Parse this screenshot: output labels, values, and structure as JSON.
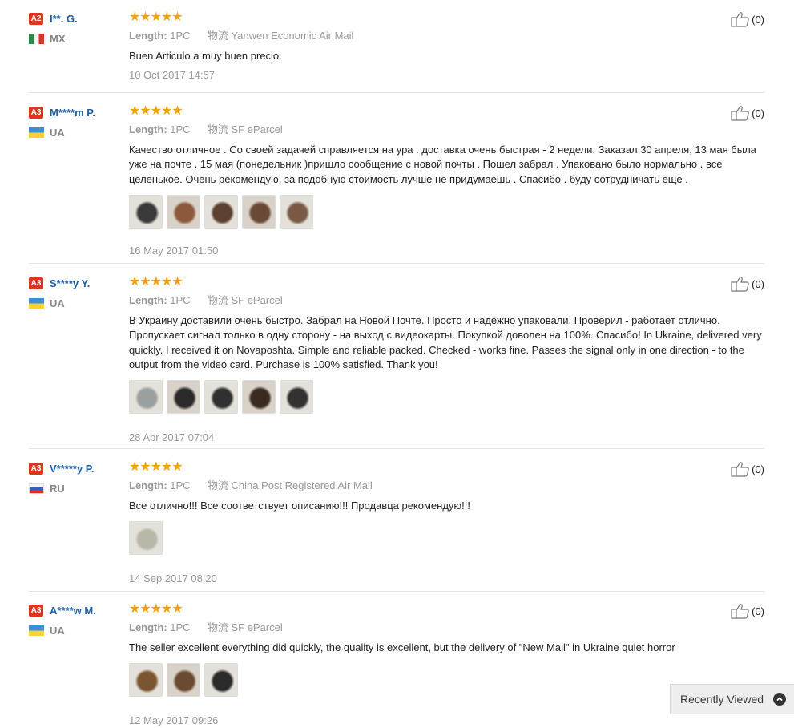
{
  "labels": {
    "length": "Length:",
    "shipping": "物流"
  },
  "reviews": [
    {
      "level": "A2",
      "user": "I**. G.",
      "country": "MX",
      "flag": "mx",
      "stars": "★★★★★",
      "quantity": "1PC",
      "shipping": "Yanwen Economic Air Mail",
      "text": "Buen Articulo a muy buen precio.",
      "photos": [],
      "date": "10 Oct 2017 14:57",
      "likes": "(0)"
    },
    {
      "level": "A3",
      "user": "M****m P.",
      "country": "UA",
      "flag": "ua",
      "stars": "★★★★★",
      "quantity": "1PC",
      "shipping": "SF eParcel",
      "text": "Качество отличное . Со своей задачей справляется на ура . доставка очень быстрая - 2 недели. Заказал 30 апреля, 13 мая была уже на почте . 15 мая (понедельник )пришло сообщение с новой почты . Пошел забрал . Упаковано было нормально . все целенькое. Очень рекомендую. за подобную стоимость лучше не придумаешь . Спасибо . буду сотрудничать еще .",
      "photos": [
        "#3a3a3a",
        "#8b5a3c",
        "#5c4030",
        "#6b4a35",
        "#7a5a45"
      ],
      "date": "16 May 2017 01:50",
      "likes": "(0)"
    },
    {
      "level": "A3",
      "user": "S****y Y.",
      "country": "UA",
      "flag": "ua",
      "stars": "★★★★★",
      "quantity": "1PC",
      "shipping": "SF eParcel",
      "text": "В Украину доставили очень быстро. Забрал на Новой Почте. Просто и надёжно упаковали. Проверил - работает отлично. Пропускает сигнал только в одну сторону - на выход с видеокарты. Покупкой доволен на 100%. Спасибо! In Ukraine, delivered very quickly. I received it on Novaposhta. Simple and reliable packed. Checked - works fine. Passes the signal only in one direction - to the output from the video card. Purchase is 100% satisfied. Thank you!",
      "photos": [
        "#9aa0a0",
        "#2a2a2a",
        "#303030",
        "#3a2a20",
        "#353030"
      ],
      "date": "28 Apr 2017 07:04",
      "likes": "(0)"
    },
    {
      "level": "A3",
      "user": "V*****y P.",
      "country": "RU",
      "flag": "ru",
      "stars": "★★★★★",
      "quantity": "1PC",
      "shipping": "China Post Registered Air Mail",
      "text": "Все отлично!!! Все соответствует описанию!!! Продавца рекомендую!!!",
      "photos": [
        "#b8b8a8"
      ],
      "date": "14 Sep 2017 08:20",
      "likes": "(0)"
    },
    {
      "level": "A3",
      "user": "A****w M.",
      "country": "UA",
      "flag": "ua",
      "stars": "★★★★★",
      "quantity": "1PC",
      "shipping": "SF eParcel",
      "text": "The seller excellent everything did quickly, the quality is excellent, but the delivery of \"New Mail\" in Ukraine quiet horror",
      "photos": [
        "#7a5530",
        "#6a4a30",
        "#2a2a2a"
      ],
      "date": "12 May 2017 09:26",
      "likes": "(0)"
    }
  ],
  "recently_viewed": {
    "label": "Recently Viewed",
    "icon": "chevron-up-icon"
  }
}
